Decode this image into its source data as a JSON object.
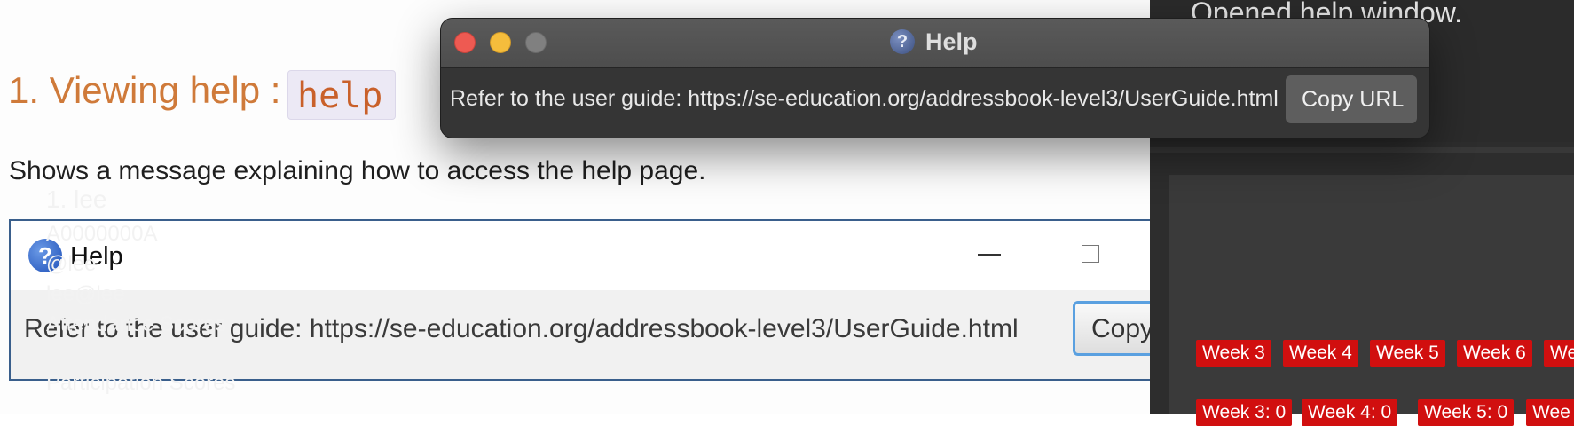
{
  "doc": {
    "heading": "1. Viewing help : ",
    "heading_code": "help",
    "description": "Shows a message explaining how to access the help page.",
    "old_window": {
      "title": "Help",
      "minimize_symbol": "—",
      "message": "Refer to the user guide: https://se-education.org/addressbook-level3/UserGuide.html",
      "copy_label": "Copy"
    }
  },
  "help_window": {
    "title": "Help",
    "message": "Refer to the user guide: https://se-education.org/addressbook-level3/UserGuide.html",
    "copy_label": "Copy URL",
    "icon": "question-circle-icon"
  },
  "app": {
    "result_text": "Opened help window.",
    "person": {
      "index_name": "1.  lee",
      "id": "A0000000A",
      "handle": "@lee",
      "email": "lee@lee",
      "attendance_header": "Attendance Scores",
      "attendance_tags": [
        "Week 3",
        "Week 4",
        "Week 5",
        "Week 6",
        "We"
      ],
      "participation_header": "Participation Scores",
      "participation_tags": [
        "Week 3: 0",
        "Week 4: 0",
        "Week 5: 0",
        "Wee"
      ]
    }
  },
  "colors": {
    "heading": "#cf7a3a",
    "tag": "#d10f0f",
    "close_light": "#ee5a52",
    "minimize_light": "#f5bd3c"
  }
}
